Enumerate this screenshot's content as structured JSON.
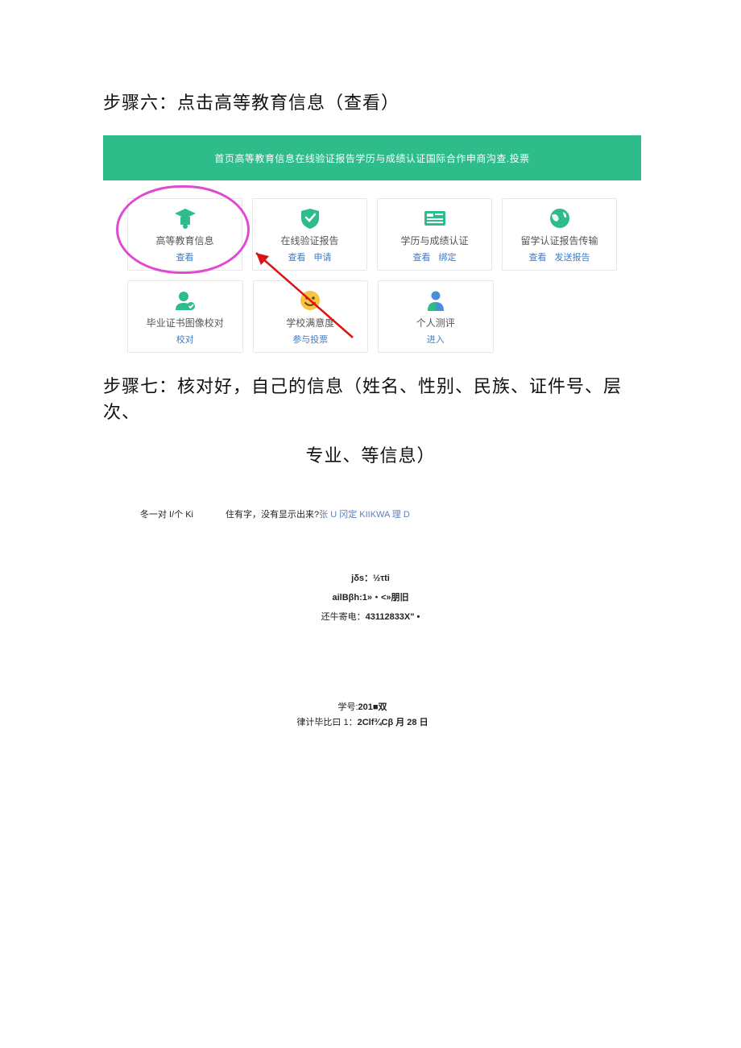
{
  "step6_title": "步骤六：点击高等教育信息（查看）",
  "nav_text": "首页高等教育信息在线验证报告学历与成绩认证国际合作申商沟查.投票",
  "cards": {
    "r1": [
      {
        "title": "高等教育信息",
        "links": [
          "查看"
        ],
        "icon": "grad"
      },
      {
        "title": "在线验证报告",
        "links": [
          "查看",
          "申请"
        ],
        "icon": "shield"
      },
      {
        "title": "学历与成绩认证",
        "links": [
          "查看",
          "绑定"
        ],
        "icon": "news"
      },
      {
        "title": "留学认证报告传输",
        "links": [
          "查看",
          "发送报告"
        ],
        "icon": "globe"
      }
    ],
    "r2": [
      {
        "title": "毕业证书图像校对",
        "links": [
          "校对"
        ],
        "icon": "usercheck"
      },
      {
        "title": "学校满意度",
        "links": [
          "参与投票"
        ],
        "icon": "smile"
      },
      {
        "title": "个人测评",
        "links": [
          "进入"
        ],
        "icon": "userhalf"
      }
    ]
  },
  "step7_line1": "步骤七：核对好，自己的信息（姓名、性别、民族、证件号、层次、",
  "step7_line2": "专业、等信息）",
  "info": {
    "left": "冬一对 I/个 Ki",
    "mid_a": "住有字，没有显示出来?",
    "mid_b": "张 U 冈定 KIIKWA 理 D",
    "stack1": "jδs：½τti",
    "stack2": "ailBβh:1»・<»朋旧",
    "stack3_a": "还牛寄电：",
    "stack3_b": "43112833X\" •",
    "lower1_a": "学号:",
    "lower1_b": "201■双",
    "lower2_a": "律计毕比曰 1：",
    "lower2_b": "2Clf¾Cβ 月 28 日"
  }
}
